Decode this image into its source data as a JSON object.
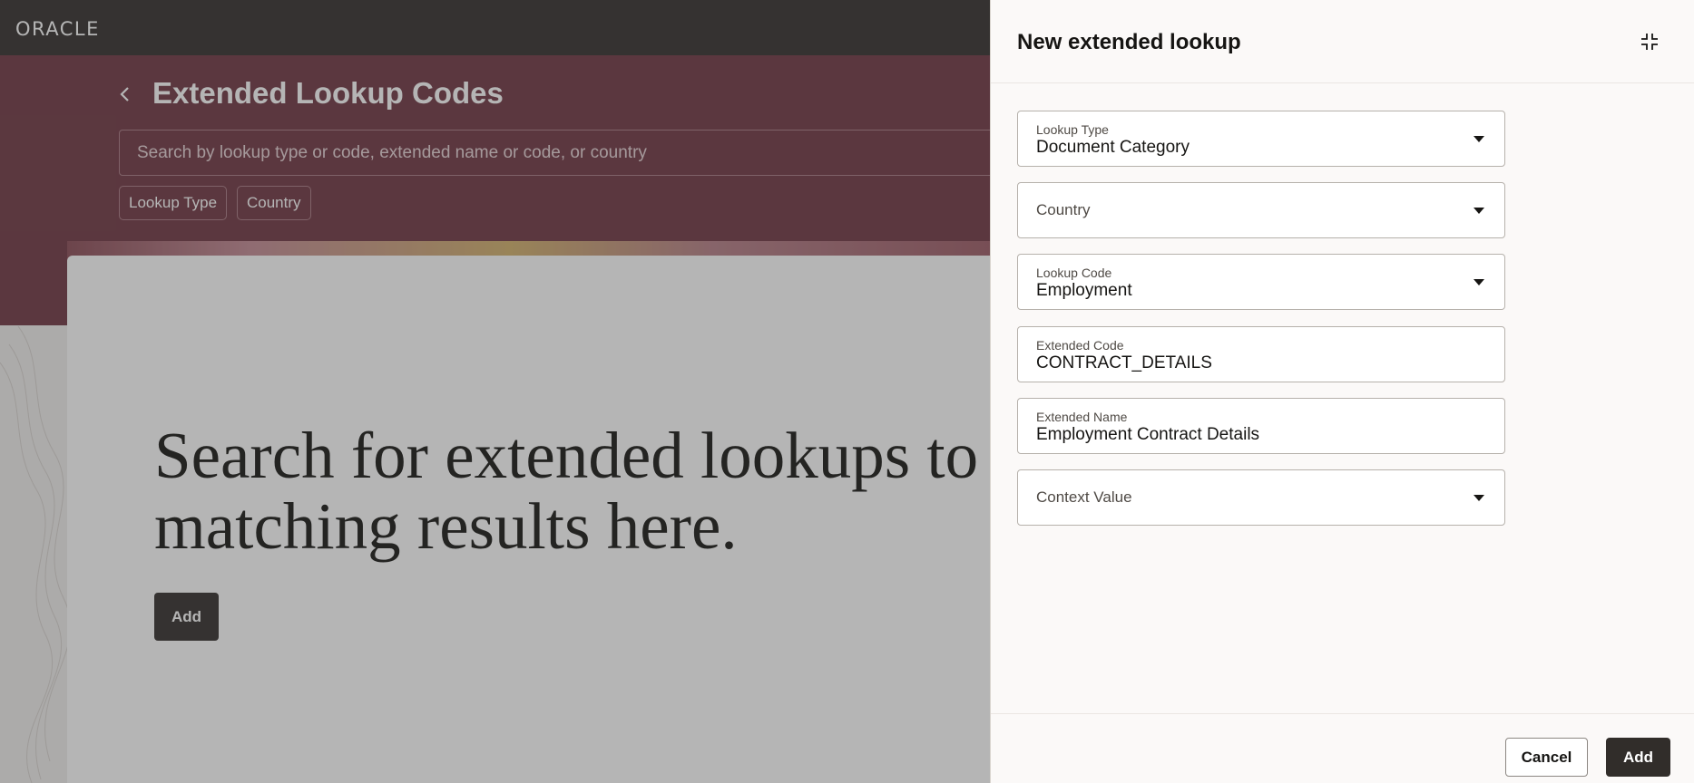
{
  "header": {
    "logo": "ORACLE"
  },
  "page": {
    "title": "Extended Lookup Codes",
    "search_placeholder": "Search by lookup type or code, extended name or code, or country",
    "filters": [
      "Lookup Type",
      "Country"
    ],
    "empty_heading": "Search for extended lookups to see matching results here.",
    "add_label": "Add"
  },
  "drawer": {
    "title": "New extended lookup",
    "fields": [
      {
        "label": "Lookup Type",
        "value": "Document Category",
        "type": "select"
      },
      {
        "label": "Country",
        "value": "",
        "type": "select"
      },
      {
        "label": "Lookup Code",
        "value": "Employment",
        "type": "select"
      },
      {
        "label": "Extended Code",
        "value": "CONTRACT_DETAILS",
        "type": "text"
      },
      {
        "label": "Extended Name",
        "value": "Employment Contract Details",
        "type": "text"
      },
      {
        "label": "Context Value",
        "value": "",
        "type": "select"
      }
    ],
    "cancel_label": "Cancel",
    "add_label": "Add"
  },
  "colors": {
    "topbar": "#312d2a",
    "hero": "#6e3541",
    "primary_button": "#312d2a",
    "drawer_bg": "#fbf9f8"
  },
  "icons": [
    "back-icon",
    "collapse-icon",
    "chevron-down-icon"
  ]
}
